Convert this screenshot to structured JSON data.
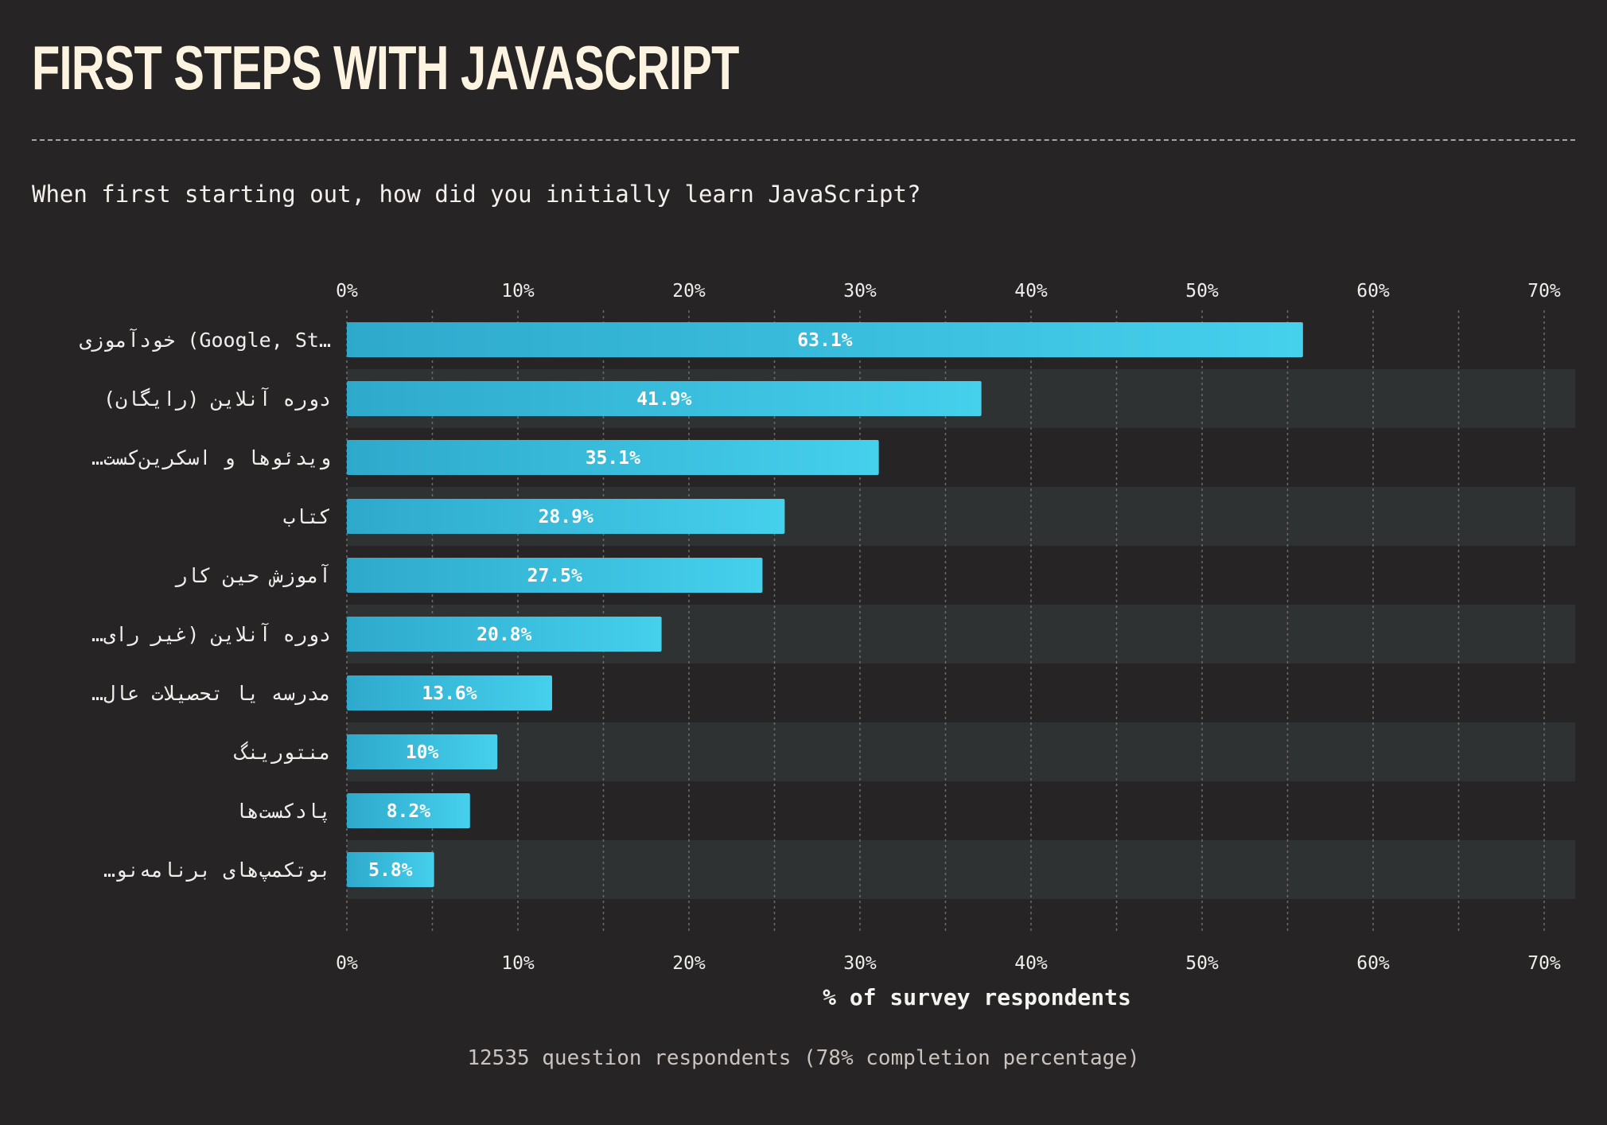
{
  "header": {
    "title": "FIRST STEPS WITH JAVASCRIPT",
    "question": "When first starting out, how did you initially learn JavaScript?"
  },
  "footer": {
    "respondents": "12535 question respondents (78% completion percentage)"
  },
  "colors": {
    "background": "#262425",
    "bar_start": "#2ea9cc",
    "bar_end": "#45d0ec",
    "row_band": "#2f3233",
    "gridline": "#6f6c6a",
    "title": "#fdf3e1"
  },
  "chart_data": {
    "type": "bar",
    "orientation": "horizontal",
    "categories": [
      "خودآموزی (Google, St…",
      "دوره آنلاین (رایگان)",
      "…ویدئوها و اسکرین‌کست",
      "کتاب",
      "آموزش حین کار",
      "…دوره آنلاین (غیر رای",
      "…مدرسه یا تحصیلات عال",
      "منتورینگ",
      "پادکست‌ها",
      "…بوتکمپ‌های برنامه‌نو"
    ],
    "values": [
      55.9,
      37.1,
      31.1,
      25.6,
      24.3,
      18.4,
      12.0,
      8.8,
      7.2,
      5.1
    ],
    "value_labels": [
      "63.1%",
      "41.9%",
      "35.1%",
      "28.9%",
      "27.5%",
      "20.8%",
      "13.6%",
      "10%",
      "8.2%",
      "5.8%"
    ],
    "xlim": [
      0,
      72
    ],
    "xticks": [
      0,
      10,
      20,
      30,
      40,
      50,
      60,
      70
    ],
    "xtick_labels": [
      "0%",
      "10%",
      "20%",
      "30%",
      "40%",
      "50%",
      "60%",
      "70%"
    ],
    "xlabel": "% of survey respondents",
    "grid": true,
    "minor_grid_step": 5
  }
}
